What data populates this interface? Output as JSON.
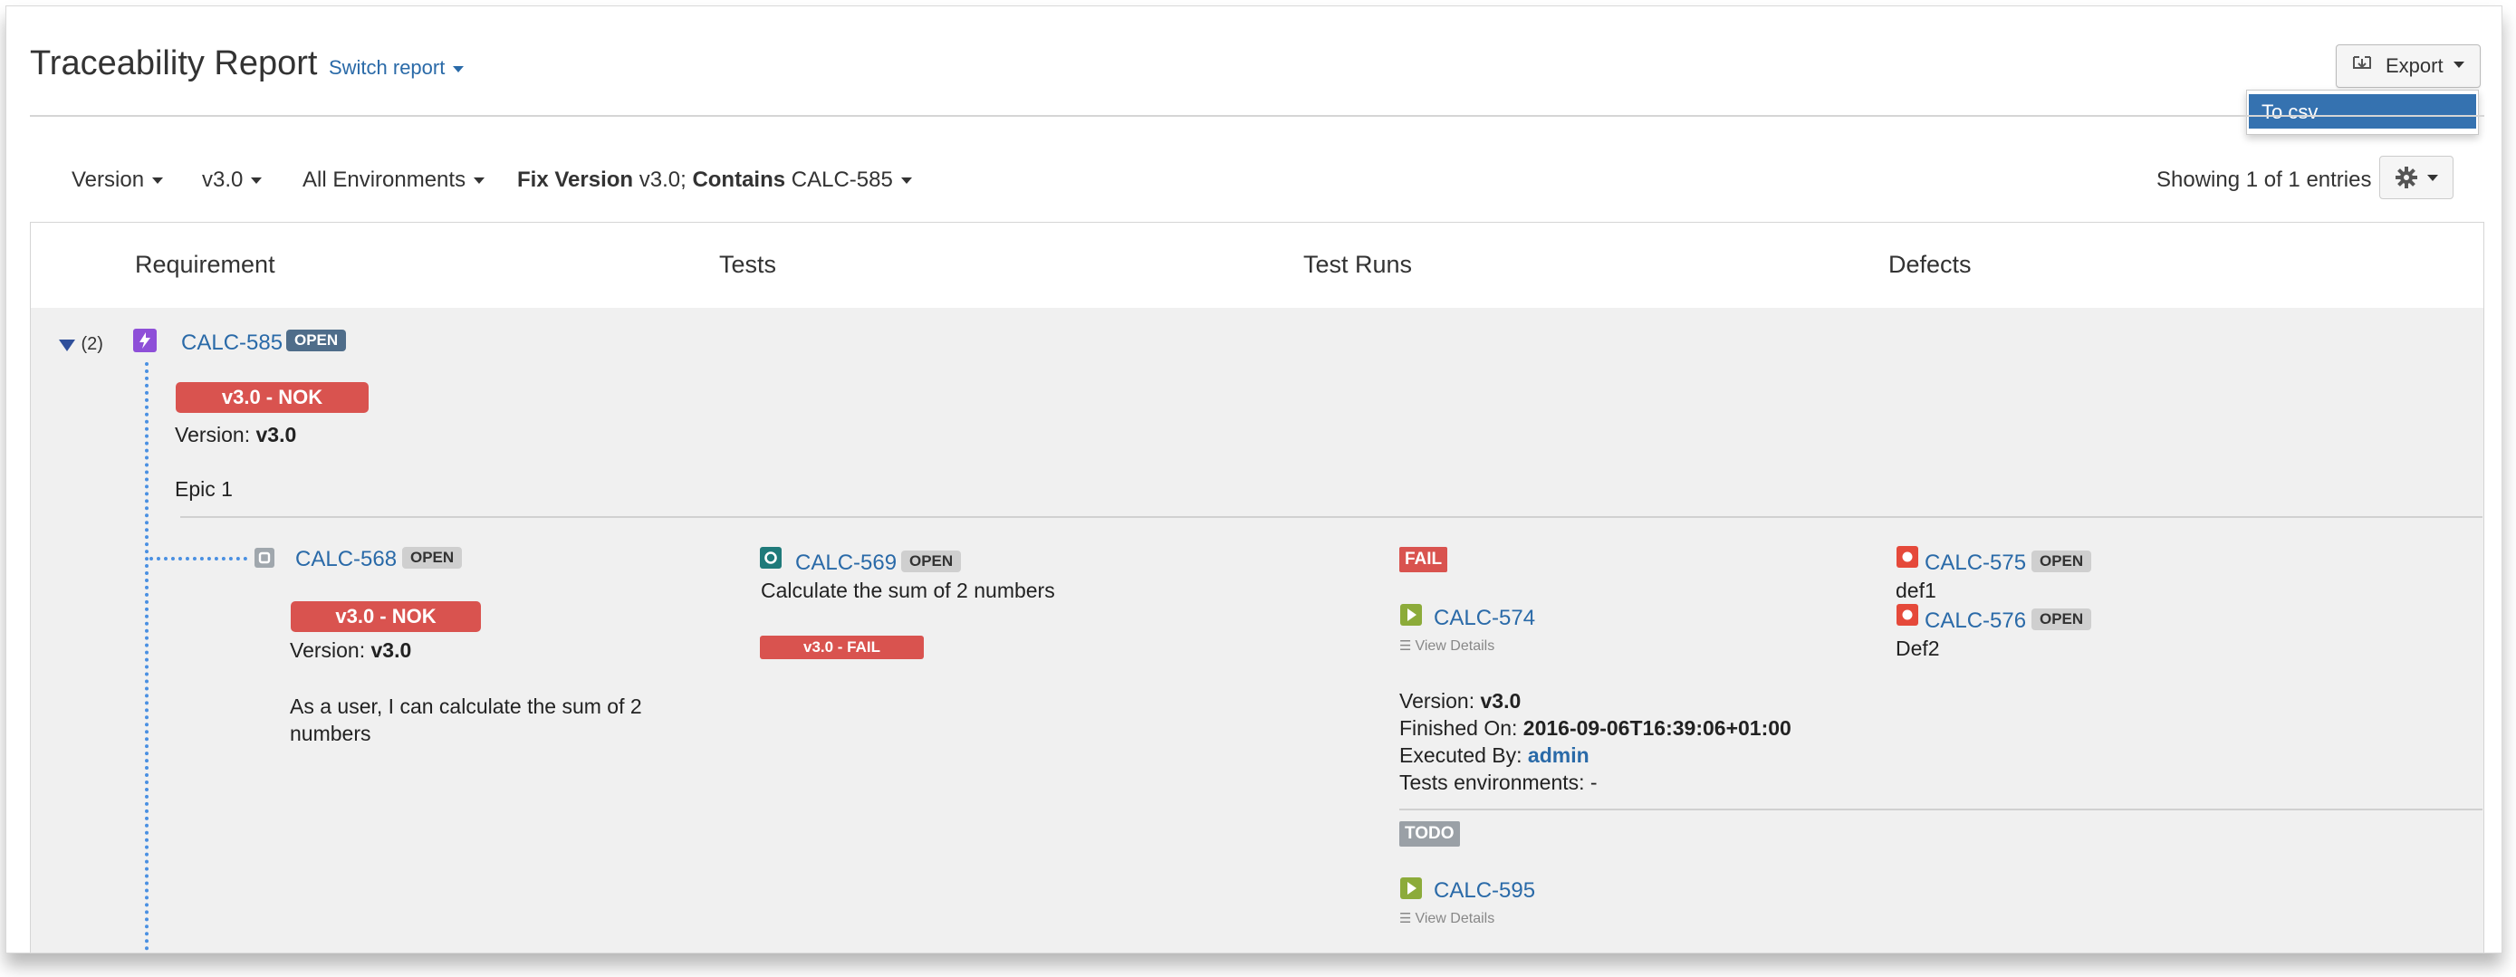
{
  "header": {
    "title": "Traceability Report",
    "switch_report": "Switch report",
    "export_label": "Export",
    "export_menu": [
      "To csv"
    ]
  },
  "filters": {
    "version": "Version",
    "version_value": "v3.0",
    "environments": "All Environments",
    "fix_version_label": "Fix Version",
    "fix_version_value": "v3.0;",
    "contains_label": "Contains",
    "contains_value": "CALC-585",
    "showing": "Showing 1 of 1 entries"
  },
  "columns": [
    "Requirement",
    "Tests",
    "Test Runs",
    "Defects"
  ],
  "requirement": {
    "expand_count": "(2)",
    "key": "CALC-585",
    "status": "OPEN",
    "coverage": "v3.0 - NOK",
    "version_label": "Version:",
    "version_value": "v3.0",
    "summary": "Epic 1"
  },
  "child": {
    "key": "CALC-568",
    "status": "OPEN",
    "coverage": "v3.0 - NOK",
    "version_label": "Version:",
    "version_value": "v3.0",
    "summary": "As a user, I can calculate the sum of 2 numbers"
  },
  "test": {
    "key": "CALC-569",
    "status": "OPEN",
    "summary": "Calculate the sum of 2 numbers",
    "result": "v3.0 - FAIL"
  },
  "runs": [
    {
      "status": "FAIL",
      "key": "CALC-574",
      "view_details": "View Details",
      "version_label": "Version:",
      "version_value": "v3.0",
      "finished_label": "Finished On:",
      "finished_value": "2016-09-06T16:39:06+01:00",
      "executed_label": "Executed By:",
      "executed_value": "admin",
      "env_label": "Tests environments:",
      "env_value": "-"
    },
    {
      "status": "TODO",
      "key": "CALC-595",
      "view_details": "View Details"
    }
  ],
  "defects": [
    {
      "key": "CALC-575",
      "status": "OPEN",
      "summary": "def1"
    },
    {
      "key": "CALC-576",
      "status": "OPEN",
      "summary": "Def2"
    }
  ],
  "colors": {
    "link": "#2a6aa8",
    "nok": "#d9534f",
    "epic": "#8e4fd8",
    "test": "#1f7a7a",
    "run": "#8cab3a",
    "bug": "#e5493a",
    "todo": "#9aa0a6",
    "dotted": "#4a90e2"
  }
}
